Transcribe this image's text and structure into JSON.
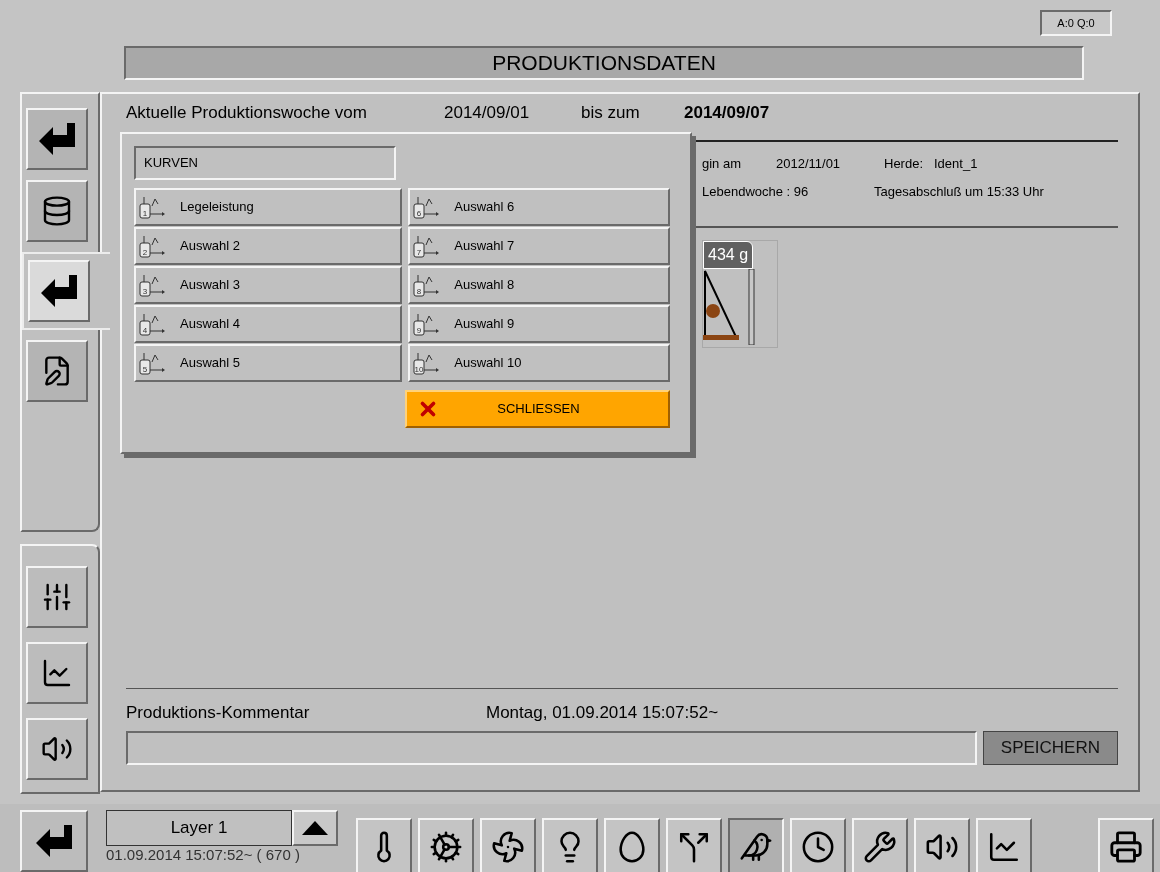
{
  "status": "A:0 Q:0",
  "title": "PRODUKTIONSDATEN",
  "sidebar": {
    "upper": [
      {
        "kind": "return",
        "selected": false
      },
      {
        "kind": "database",
        "selected": false
      },
      {
        "kind": "return",
        "selected": true
      },
      {
        "kind": "edit",
        "selected": false
      }
    ],
    "lower": [
      {
        "kind": "sliders"
      },
      {
        "kind": "chart"
      },
      {
        "kind": "speaker"
      }
    ]
  },
  "week": {
    "label": "Aktuelle Produktionswoche vom",
    "from": "2014/09/01",
    "to_label": "bis zum",
    "to": "2014/09/07"
  },
  "info": {
    "start_label": "gin am",
    "start": "2012/11/01",
    "flock_label": "Herde:",
    "flock": "Ident_1",
    "week_of_life": "Lebendwoche : 96",
    "closing": "Tagesabschluß um 15:33 Uhr"
  },
  "weight": "434 g",
  "comment": {
    "label": "Produktions-Kommentar",
    "timestamp": "Montag, 01.09.2014 15:07:52~",
    "save": "SPEICHERN"
  },
  "popup": {
    "title": "KURVEN",
    "close": "SCHLIESSEN",
    "items": [
      {
        "number": "1",
        "label": "Legeleistung"
      },
      {
        "number": "2",
        "label": "Auswahl 2"
      },
      {
        "number": "3",
        "label": "Auswahl 3"
      },
      {
        "number": "4",
        "label": "Auswahl 4"
      },
      {
        "number": "5",
        "label": "Auswahl 5"
      },
      {
        "number": "6",
        "label": "Auswahl 6"
      },
      {
        "number": "7",
        "label": "Auswahl 7"
      },
      {
        "number": "8",
        "label": "Auswahl 8"
      },
      {
        "number": "9",
        "label": "Auswahl 9"
      },
      {
        "number": "10",
        "label": "Auswahl 10"
      }
    ]
  },
  "footer": {
    "layer": "Layer 1",
    "timestamp": "01.09.2014 15:07:52~ ( 670 )",
    "tools": [
      {
        "kind": "thermometer",
        "selected": false
      },
      {
        "kind": "feeder",
        "selected": false
      },
      {
        "kind": "fan",
        "selected": false
      },
      {
        "kind": "water-light",
        "selected": false
      },
      {
        "kind": "egg-counter",
        "selected": false
      },
      {
        "kind": "egg-sorting",
        "selected": false
      },
      {
        "kind": "flock",
        "selected": true
      },
      {
        "kind": "timer",
        "selected": false
      },
      {
        "kind": "tools",
        "selected": false
      },
      {
        "kind": "speaker",
        "selected": false
      },
      {
        "kind": "chart",
        "selected": false
      }
    ]
  }
}
